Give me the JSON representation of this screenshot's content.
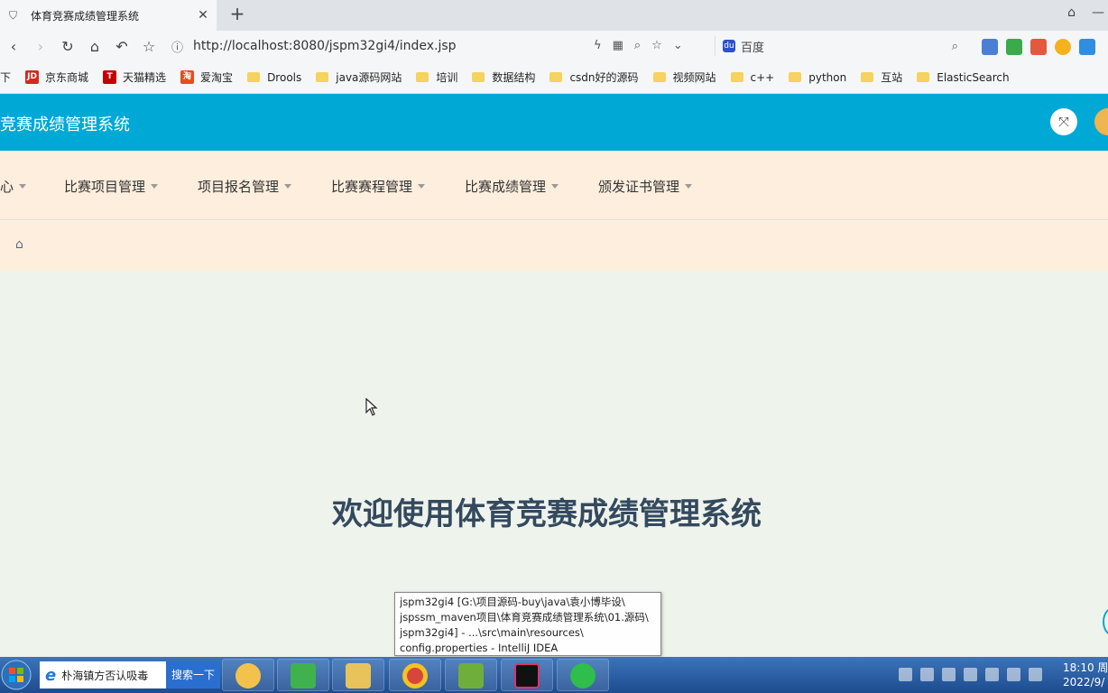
{
  "browser": {
    "tab_title": "体育竞赛成绩管理系统",
    "tab_close": "✕",
    "new_tab": "+",
    "url": "http://localhost:8080/jspm32gi4/index.jsp",
    "search_placeholder": "百度",
    "bookmarks": [
      {
        "label": "下",
        "type": "text"
      },
      {
        "label": "京东商城",
        "type": "logo",
        "color": "#d6281e",
        "mark": "JD"
      },
      {
        "label": "天猫精选",
        "type": "logo",
        "color": "#c40000",
        "mark": "T"
      },
      {
        "label": "爱淘宝",
        "type": "logo",
        "color": "#e94b1c",
        "mark": "淘"
      },
      {
        "label": "Drools",
        "type": "folder"
      },
      {
        "label": "java源码网站",
        "type": "folder"
      },
      {
        "label": "培训",
        "type": "folder"
      },
      {
        "label": "数据结构",
        "type": "folder"
      },
      {
        "label": "csdn好的源码",
        "type": "folder"
      },
      {
        "label": "视频网站",
        "type": "folder"
      },
      {
        "label": "c++",
        "type": "folder"
      },
      {
        "label": "python",
        "type": "folder"
      },
      {
        "label": "互站",
        "type": "folder"
      },
      {
        "label": "ElasticSearch",
        "type": "folder"
      }
    ]
  },
  "app": {
    "title": "竞赛成绩管理系统",
    "menu": [
      {
        "label": "心"
      },
      {
        "label": "比赛项目管理"
      },
      {
        "label": "项目报名管理"
      },
      {
        "label": "比赛赛程管理"
      },
      {
        "label": "比赛成绩管理"
      },
      {
        "label": "颁发证书管理"
      }
    ],
    "welcome": "欢迎使用体育竞赛成绩管理系统",
    "colors": {
      "header": "#00a8d6",
      "menu_bg": "#fdeedd",
      "content_bg": "#eef3ec",
      "welcome": "#34495e"
    }
  },
  "tooltip": {
    "lines": [
      "jspm32gi4 [G:\\项目源码-buy\\java\\袁小博毕设\\",
      "jspssm_maven项目\\体育竞赛成绩管理系统\\01.源码\\",
      "jspm32gi4] - ...\\src\\main\\resources\\",
      "config.properties - IntelliJ IDEA"
    ]
  },
  "taskbar": {
    "ie_text": "朴海镇方否认吸毒",
    "search_button": "搜索一下",
    "time": "18:10 周",
    "date": "2022/9/"
  }
}
